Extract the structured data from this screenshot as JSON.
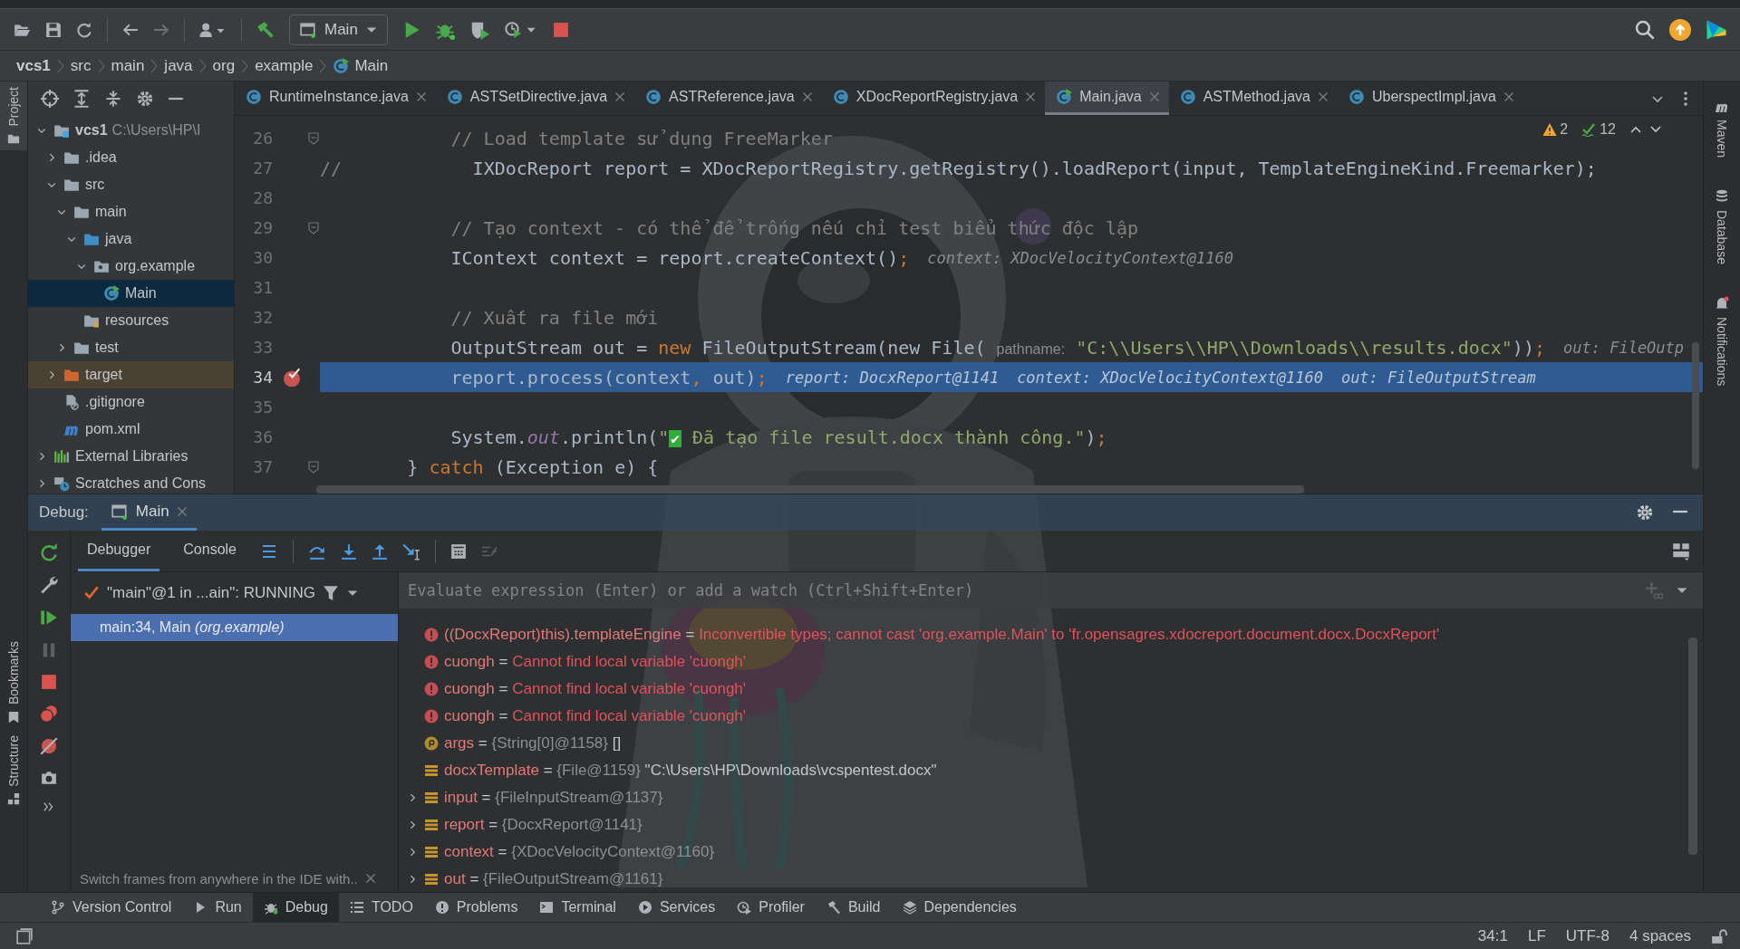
{
  "toolbar": {
    "run_configuration": "Main"
  },
  "breadcrumbs": [
    {
      "label": "vcs1",
      "kind": "project"
    },
    {
      "label": "src",
      "kind": "folder"
    },
    {
      "label": "main",
      "kind": "folder"
    },
    {
      "label": "java",
      "kind": "folder"
    },
    {
      "label": "org",
      "kind": "folder"
    },
    {
      "label": "example",
      "kind": "folder"
    },
    {
      "label": "Main",
      "kind": "class"
    }
  ],
  "tool_stripes": {
    "left_top": [
      "Project"
    ],
    "left_bottom": [
      "Bookmarks",
      "Structure"
    ],
    "right": [
      "Maven",
      "Database",
      "Notifications"
    ]
  },
  "project_tree": {
    "items": [
      {
        "label": "vcs1",
        "kind": "project",
        "path": "C:\\Users\\HP\\I",
        "expanded": true,
        "selected": false,
        "children": [
          {
            "label": ".idea",
            "kind": "folder",
            "expanded": false,
            "selected": false
          },
          {
            "label": "src",
            "kind": "folder",
            "expanded": true,
            "selected": false,
            "children": [
              {
                "label": "main",
                "kind": "folder",
                "expanded": true,
                "selected": false,
                "children": [
                  {
                    "label": "java",
                    "kind": "source-folder",
                    "expanded": true,
                    "selected": false,
                    "children": [
                      {
                        "label": "org.example",
                        "kind": "package",
                        "expanded": true,
                        "selected": false,
                        "children": [
                          {
                            "label": "Main",
                            "kind": "class",
                            "selected": true
                          }
                        ]
                      }
                    ]
                  },
                  {
                    "label": "resources",
                    "kind": "resources-folder",
                    "selected": false
                  }
                ]
              },
              {
                "label": "test",
                "kind": "folder",
                "expanded": false,
                "selected": false
              }
            ]
          },
          {
            "label": "target",
            "kind": "excluded-folder",
            "expanded": false,
            "selected": false
          },
          {
            "label": ".gitignore",
            "kind": "ignore-file",
            "selected": false
          },
          {
            "label": "pom.xml",
            "kind": "maven-file",
            "selected": false
          }
        ]
      },
      {
        "label": "External Libraries",
        "kind": "libraries",
        "expanded": false,
        "selected": false
      },
      {
        "label": "Scratches and Cons",
        "kind": "scratches",
        "expanded": false,
        "selected": false
      }
    ]
  },
  "editor": {
    "tabs": [
      {
        "label": "RuntimeInstance.java",
        "kind": "class",
        "selected": false
      },
      {
        "label": "ASTSetDirective.java",
        "kind": "class",
        "selected": false
      },
      {
        "label": "ASTReference.java",
        "kind": "class",
        "selected": false
      },
      {
        "label": "XDocReportRegistry.java",
        "kind": "class",
        "selected": false
      },
      {
        "label": "Main.java",
        "kind": "main-class",
        "selected": true
      },
      {
        "label": "ASTMethod.java",
        "kind": "class",
        "selected": false
      },
      {
        "label": "UberspectImpl.java",
        "kind": "class",
        "selected": false
      }
    ],
    "inspections": {
      "warnings": "2",
      "checks": "12"
    },
    "lines": [
      {
        "number": "26",
        "fold": true,
        "breakpoint": false,
        "current": false,
        "segments": [
          {
            "text": "            // Load template sử dụng FreeMarker",
            "kind": "comment"
          }
        ]
      },
      {
        "number": "27",
        "fold": false,
        "breakpoint": false,
        "current": false,
        "segments": [
          {
            "text": "//",
            "kind": "comment"
          },
          {
            "text": "            IXDocReport report = XDocReportRegistry.getRegistry().loadReport(input, TemplateEngineKind.Freemarker);",
            "kind": "plain"
          }
        ]
      },
      {
        "number": "28",
        "fold": false,
        "breakpoint": false,
        "current": false
      },
      {
        "number": "29",
        "fold": true,
        "breakpoint": false,
        "current": false,
        "segments": [
          {
            "text": "            // Tạo context - có thể để trống nếu chỉ test biểu thức độc lập",
            "kind": "comment"
          }
        ]
      },
      {
        "number": "30",
        "fold": false,
        "breakpoint": false,
        "current": false,
        "segments": [
          {
            "text": "            IContext context = report.createContext()",
            "kind": "plain"
          },
          {
            "text": ";",
            "kind": "keyword"
          }
        ],
        "hints": [
          "context: XDocVelocityContext@1160"
        ]
      },
      {
        "number": "31",
        "fold": false,
        "breakpoint": false,
        "current": false
      },
      {
        "number": "32",
        "fold": false,
        "breakpoint": false,
        "current": false,
        "segments": [
          {
            "text": "            // Xuất ra file mới",
            "kind": "comment"
          }
        ]
      },
      {
        "number": "33",
        "fold": false,
        "breakpoint": false,
        "current": false,
        "segments": [
          {
            "text": "            OutputStream out = ",
            "kind": "plain"
          },
          {
            "text": "new",
            "kind": "keyword"
          },
          {
            "text": " FileOutputStream(new File( ",
            "kind": "plain"
          },
          {
            "text": "pathname:",
            "kind": "param"
          },
          {
            "text": " \"C:\\\\Users\\\\HP\\\\Downloads\\\\results.docx\"",
            "kind": "string"
          },
          {
            "text": "))",
            "kind": "plain"
          },
          {
            "text": ";",
            "kind": "keyword"
          }
        ],
        "hints": [
          "out: FileOutp"
        ]
      },
      {
        "number": "34",
        "fold": false,
        "breakpoint": true,
        "current": true,
        "segments": [
          {
            "text": "            report.process(context",
            "kind": "plain"
          },
          {
            "text": ",",
            "kind": "keyword"
          },
          {
            "text": " out)",
            "kind": "plain"
          },
          {
            "text": ";",
            "kind": "keyword"
          }
        ],
        "hints": [
          "report: DocxReport@1141",
          "context: XDocVelocityContext@1160",
          "out: FileOutputStream"
        ]
      },
      {
        "number": "35",
        "fold": false,
        "breakpoint": false,
        "current": false
      },
      {
        "number": "36",
        "fold": false,
        "breakpoint": false,
        "current": false,
        "segments": [
          {
            "text": "            System.",
            "kind": "plain"
          },
          {
            "text": "out",
            "kind": "field"
          },
          {
            "text": ".println(",
            "kind": "plain"
          },
          {
            "text": "\"",
            "kind": "string"
          },
          {
            "text": "✔",
            "kind": "emoji"
          },
          {
            "text": " Đã tạo file result.docx thành công.\"",
            "kind": "string"
          },
          {
            "text": ")",
            "kind": "plain"
          },
          {
            "text": ";",
            "kind": "keyword"
          }
        ]
      },
      {
        "number": "37",
        "fold": true,
        "breakpoint": false,
        "current": false,
        "segments": [
          {
            "text": "        } ",
            "kind": "plain"
          },
          {
            "text": "catch",
            "kind": "keyword"
          },
          {
            "text": " (Exception e) {",
            "kind": "plain"
          }
        ]
      }
    ]
  },
  "debug": {
    "title": "Debug:",
    "session_tab": "Main",
    "tabs": [
      {
        "label": "Debugger",
        "selected": true
      },
      {
        "label": "Console",
        "selected": false
      }
    ],
    "thread": "\"main\"@1 in ...ain\": RUNNING",
    "frames": [
      {
        "label": "main:34, Main *(org.example)*",
        "selected": true
      }
    ],
    "hint": "Switch frames from anywhere in the IDE with..",
    "evaluate": {
      "placeholder": "Evaluate expression (Enter) or add a watch (Ctrl+Shift+Enter)"
    },
    "variables": [
      {
        "kind": "error",
        "name": "((DocxReport)this).templateEngine",
        "equals": "=",
        "message": "Inconvertible types; cannot cast 'org.example.Main' to 'fr.opensagres.xdocreport.document.docx.DocxReport'"
      },
      {
        "kind": "error",
        "name": "cuongh",
        "equals": "=",
        "message": "Cannot find local variable 'cuongh'"
      },
      {
        "kind": "error",
        "name": "cuongh",
        "equals": "=",
        "message": "Cannot find local variable 'cuongh'"
      },
      {
        "kind": "error",
        "name": "cuongh",
        "equals": "=",
        "message": "Cannot find local variable 'cuongh'"
      },
      {
        "kind": "param",
        "name": "args",
        "equals": "=",
        "ref": "{String[0]@1158}",
        "value": "[]"
      },
      {
        "kind": "field",
        "name": "docxTemplate",
        "equals": "=",
        "ref": "{File@1159}",
        "value": "\"C:\\Users\\HP\\Downloads\\vcspentest.docx\""
      },
      {
        "kind": "field",
        "name": "input",
        "equals": "=",
        "ref": "{FileInputStream@1137}",
        "expanded": false
      },
      {
        "kind": "field",
        "name": "report",
        "equals": "=",
        "ref": "{DocxReport@1141}",
        "expanded": false
      },
      {
        "kind": "field",
        "name": "context",
        "equals": "=",
        "ref": "{XDocVelocityContext@1160}",
        "expanded": false
      },
      {
        "kind": "field",
        "name": "out",
        "equals": "=",
        "ref": "{FileOutputStream@1161}",
        "expanded": false
      }
    ]
  },
  "tool_windows": [
    {
      "label": "Version Control",
      "kind": "vcs",
      "selected": false
    },
    {
      "label": "Run",
      "kind": "run",
      "selected": false
    },
    {
      "label": "Debug",
      "kind": "debug",
      "selected": true
    },
    {
      "label": "TODO",
      "kind": "todo",
      "selected": false
    },
    {
      "label": "Problems",
      "kind": "problems",
      "selected": false
    },
    {
      "label": "Terminal",
      "kind": "terminal",
      "selected": false
    },
    {
      "label": "Services",
      "kind": "services",
      "selected": false
    },
    {
      "label": "Profiler",
      "kind": "profiler",
      "selected": false
    },
    {
      "label": "Build",
      "kind": "build",
      "selected": false
    },
    {
      "label": "Dependencies",
      "kind": "dependencies",
      "selected": false
    }
  ],
  "status_bar": {
    "position": "34:1",
    "line_separator": "LF",
    "encoding": "UTF-8",
    "indent": "4 spaces"
  }
}
